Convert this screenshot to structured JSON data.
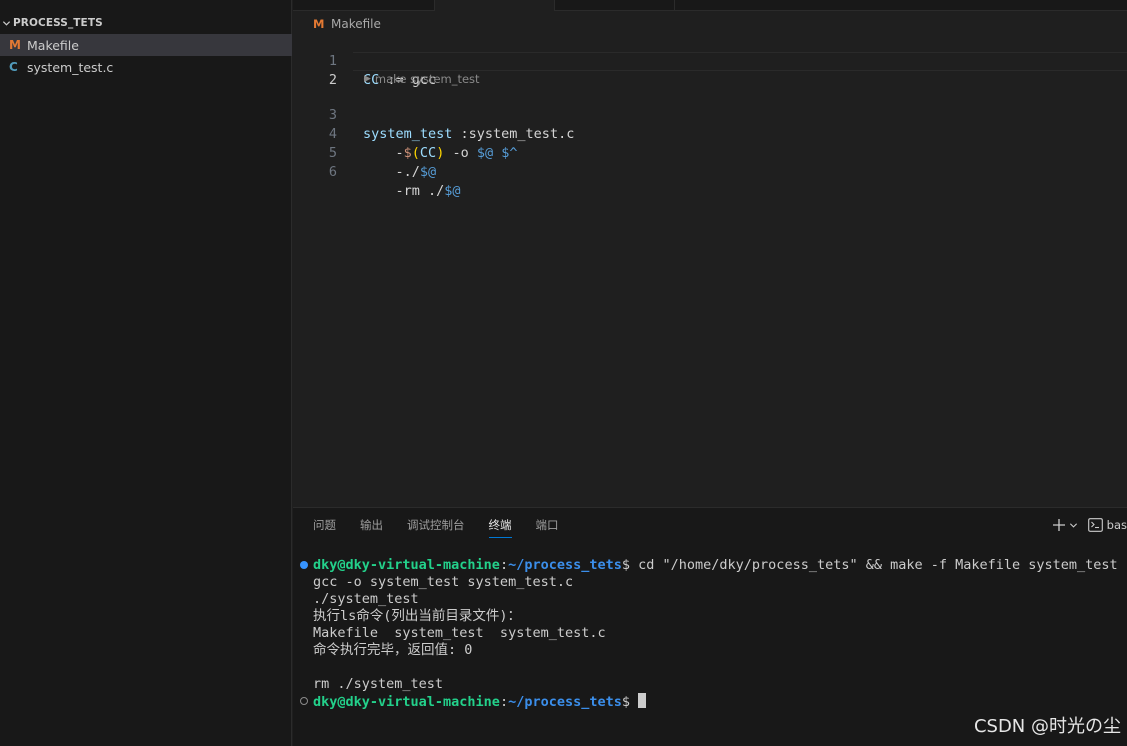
{
  "explorer": {
    "folder_name": "PROCESS_TETS",
    "files": [
      {
        "icon": "M",
        "name": "Makefile",
        "selected": true
      },
      {
        "icon": "C",
        "name": "system_test.c",
        "selected": false
      }
    ]
  },
  "editor": {
    "breadcrumb_icon": "M",
    "breadcrumb_file": "Makefile",
    "codelens": "make system_test",
    "line_numbers": [
      "1",
      "2",
      "3",
      "4",
      "5",
      "6"
    ],
    "lines": {
      "l1": {
        "var": "CC",
        "op": " := ",
        "val": "gcc"
      },
      "l3": {
        "target": "system_test",
        "rest": " :system_test.c"
      },
      "l4": {
        "indent": "    -",
        "dollar": "$",
        "paren_open": "(",
        "var": "CC",
        "paren_close": ")",
        "mid": " -o ",
        "auto1": "$@",
        "sp": " ",
        "auto2": "$^"
      },
      "l5": {
        "indent": "    -./",
        "auto": "$@"
      },
      "l6": {
        "indent": "    -rm ./",
        "auto": "$@"
      }
    }
  },
  "panel": {
    "tabs": [
      "问题",
      "输出",
      "调试控制台",
      "终端",
      "端口"
    ],
    "active_tab": "终端",
    "terminal_name": "bas"
  },
  "terminal": {
    "prompt_user": "dky@dky-virtual-machine",
    "prompt_sep": ":",
    "prompt_path": "~/process_tets",
    "prompt_dollar": "$ ",
    "command": "cd \"/home/dky/process_tets\" && make -f Makefile system_test",
    "output": [
      "gcc -o system_test system_test.c",
      "./system_test",
      "执行ls命令(列出当前目录文件)：",
      "Makefile  system_test  system_test.c",
      "命令执行完毕，返回值: 0",
      "",
      "rm ./system_test"
    ]
  },
  "watermark": "CSDN @时光の尘",
  "colors": {
    "editor_bg": "#1f1f1f",
    "sidebar_bg": "#181818",
    "accent": "#0078d4",
    "prompt_user": "#23d18b",
    "prompt_path": "#3b8eea"
  }
}
